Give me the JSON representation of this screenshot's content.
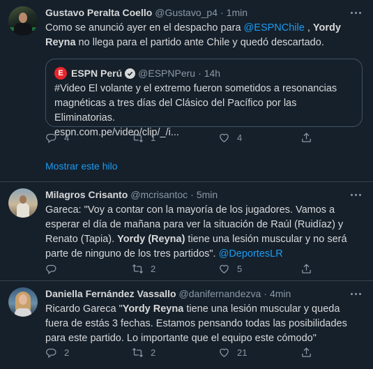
{
  "tweets": [
    {
      "name": "Gustavo Peralta Coello",
      "handle": "@Gustavo_p4",
      "sep": "·",
      "time": "1min",
      "text_parts": [
        "Como se anunció ayer en el despacho para ",
        "@ESPNChile",
        " , ",
        "Yordy Reyna",
        " no llega para el partido ante Chile y quedó descartado."
      ],
      "quote": {
        "logo": "E",
        "name": "ESPN Perú",
        "handle": "@ESPNPeru",
        "sep": "·",
        "time": "14h",
        "text": "#Video El volante y el extremo fueron sometidos a resonancias magnéticas a tres días del Clásico del Pacífico por las Eliminatorias.",
        "link": "espn.com.pe/video/clip/_/i..."
      },
      "replies": "4",
      "retweets": "1",
      "likes": "4",
      "show_thread": "Mostrar este hilo"
    },
    {
      "name": "Milagros Crisanto",
      "handle": "@mcrisantoc",
      "sep": "·",
      "time": "5min",
      "text_parts": [
        "Gareca: \"Voy a contar con la mayoría de los jugadores.  Vamos a esperar el día de mañana para ver la situación de Raúl (Ruidíaz) y Renato (Tapia). ",
        "Yordy (Reyna)",
        " tiene una lesión muscular y no será parte de ninguno de los tres partidos\". ",
        "@DeportesLR"
      ],
      "replies": "",
      "retweets": "2",
      "likes": "5"
    },
    {
      "name": "Daniella Fernández Vassallo",
      "handle": "@danifernandezva",
      "sep": "·",
      "time": "4min",
      "text_parts": [
        "Ricardo Gareca \"",
        "Yordy Reyna",
        " tiene una lesión muscular y queda fuera de estás 3 fechas. Estamos pensando todas las posibilidades para este partido. Lo importante que el equipo este cómodo\""
      ],
      "replies": "2",
      "retweets": "2",
      "likes": "21"
    }
  ],
  "icons": {
    "reply": "reply-icon",
    "retweet": "retweet-icon",
    "like": "heart-icon",
    "share": "share-icon",
    "more": "more-icon",
    "verified": "verified-badge-icon"
  },
  "colors": {
    "background": "#15202b",
    "accent": "#1d9bf0",
    "muted": "#8b98a5",
    "text": "#d9d9d9",
    "espn": "#e6262c"
  }
}
